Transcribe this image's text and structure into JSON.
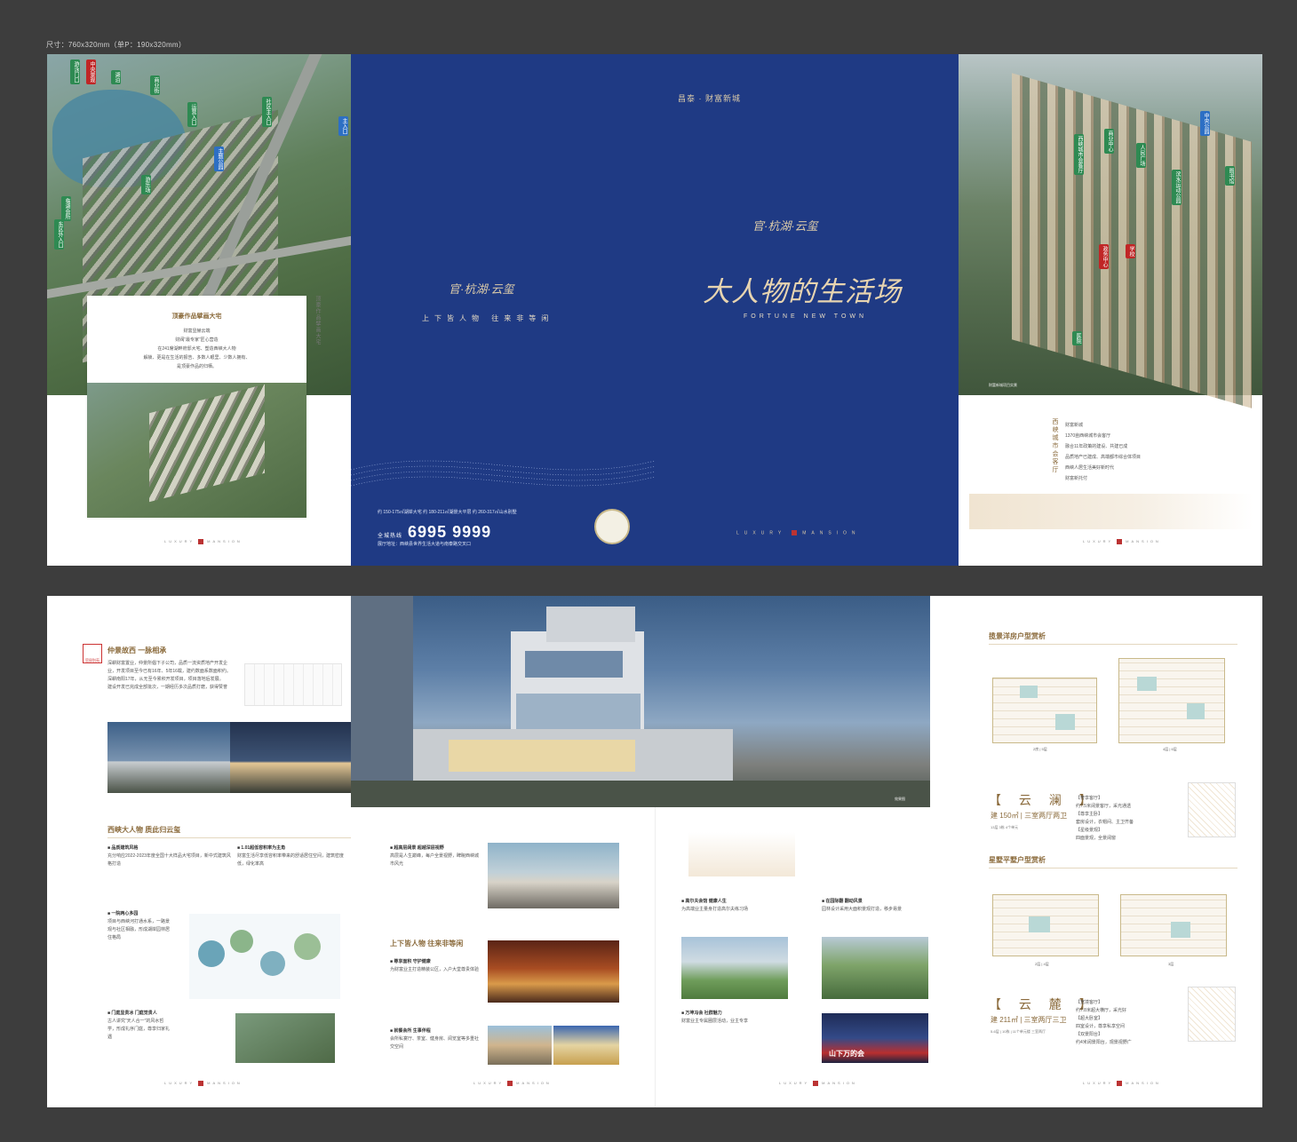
{
  "size_label": "尺寸：760x320mm（单P：190x320mm）",
  "top_left": {
    "card_title": "顶豪作品擘画大宅",
    "card_lines": [
      "财富显赫云端",
      "财阀“最专家”匠心营造",
      "在241席湖畔府邸大宅、塑造西峡大人物",
      "解锁、更是在生活的报告、多数人眼里、少数人拥有、",
      "是顶豪作品的归栖。"
    ],
    "vertical_title": "顶豪作品擘画大宅",
    "tags": [
      "游泳门口",
      "中央景观",
      "湖泊",
      "商业街",
      "运营入口",
      "社区主入口",
      "主题公园",
      "游乐场",
      "临湖会所",
      "东区外入口",
      "主入口"
    ],
    "footer_left": "LUXURY",
    "footer_right": "MANSION"
  },
  "cover": {
    "logo_small": "昌泰 · 财富新城",
    "logo_left": "官·杭湖·云玺",
    "slogan_left": "上下皆人物   往来非等闲",
    "logo_right": "官·杭湖·云玺",
    "headline": "大人物的生活场",
    "subtitle_en": "FORTUNE NEW TOWN",
    "info_lines": [
      "约 150-175㎡湖岸大宅   约 180-211㎡湖景大平层   约 260-317㎡山水别墅"
    ],
    "phone_prefix": "全城热线",
    "phone": "6995 9999",
    "address": "展厅地址：西峡县世界生活大道与南泰路交叉口",
    "lux_left": "LUXURY",
    "lux_right": "MANSION"
  },
  "top_right": {
    "tags": [
      "西峡城市会客厅",
      "中央公园",
      "商业中心",
      "人民广场",
      "滨水运动公园",
      "图书馆",
      "政务中心",
      "学校",
      "医院"
    ],
    "vertical_title": "西峡城市会客厅",
    "text_lines": [
      "财富新城",
      "1370亩西峡城市会客厅",
      "融合11年政策的建设、共建已成",
      "品质地产已建成、高端都市综合体项目",
      "西峡人居生活美好新时代",
      "财富新托付"
    ],
    "caption": "财富新城项目实景",
    "footer_left": "LUXURY",
    "footer_right": "MANSION"
  },
  "bottom": {
    "brand_badge": "官邸别苑",
    "sec1_title": "仲景故西  一脉相承",
    "sec1_lines": [
      "深耕财富置业，仲景所倡下子公司，品质一流资质地产开发企",
      "业，开发项目至今已有16年、5年16载，建约数面系数面积约。",
      "深耕南阳17年，从无至今累积开发项目，项目落地后发展。",
      "建设开发已完成全部批次，一期经历多次品质打磨，获得赞誉"
    ],
    "sec2_title": "西峡大人物  质此归云玺",
    "col1": [
      {
        "h": "■ 品质建筑风格",
        "t": "充分响应2022-2023年度全国十大样品大宅项目，新中式建筑风格打造"
      },
      {
        "h": "■ 一院两心多园",
        "t": "项目与西峡河打通水系，一路景观与社区相融，形成湖岸园林居住格局"
      },
      {
        "h": "■ 门庭显贵冰 门庭觉贵人",
        "t": "古人讲究“天人合一”的风水哲学，形成礼序门庭，尊享归家礼遇"
      }
    ],
    "col2": [
      {
        "h": "■ 1.01超低容积率为主角",
        "t": "财富生活尽享低容积率带来的舒适居住空间，建筑密度低，绿化率高"
      }
    ],
    "col3": [
      {
        "h": "■ 超高层阔景 超越深层视野",
        "t": "高层是人生巅峰，每户全景视野，睥睨西峡城市风光"
      },
      {
        "h": "■ 尊享面积 守护健康",
        "t": "为财富业主打造精装公区，入户大堂尊贵体验"
      },
      {
        "h": "■ 就餐会所 生事伴程",
        "t": "会所私宴厅、茶室、健身房、阅览室等多重社交空间"
      }
    ],
    "sec3_title": "上下皆人物  往来非等闲",
    "col4": [
      {
        "h": "■ 高尔夫会馆 健康人生",
        "t": "为高端业主量身打造高尔夫练习场"
      },
      {
        "h": "■ 万坤冯会 社群魅力",
        "t": "财富业主专属圈层活动，业主专享"
      }
    ],
    "col5": [
      {
        "h": "■ 在园际翻 翻动风景",
        "t": "园林设计采用大面积景观打造，移步易景"
      }
    ],
    "caption_hero": "效果图",
    "plan1_title": "揽景洋房户型赏析",
    "plan1_labels": [
      "2房 | 5层",
      "4层 | 6层"
    ],
    "unit1_name": "【 云 澜 】",
    "unit1_area": "建 150㎡ | 三室两厅两卫",
    "unit1_note": "13层   3栋   4个单元",
    "unit1_desc": [
      "【奢享客厅】",
      "约7.5米阔景客厅，采光通透",
      "【尊享主卧】",
      "套房设计，衣帽间、主卫齐备",
      "【星级景观】",
      "四面景观，全景阔窗"
    ],
    "plan2_title": "星墅平墅户型赏析",
    "plan2_labels": [
      "2层 | 4层",
      "3层"
    ],
    "unit2_name": "【 云 麓 】",
    "unit2_area": "建 211㎡ | 三室两厅三卫",
    "unit2_note": "5-6层 | 10栋 | 11个单元楼  三室两厅",
    "unit2_desc": [
      "【宽境客厅】",
      "约7.8米超大横厅，采光好",
      "【超大卧室】",
      "四室设计，尊享私享空间",
      "【双景阳台】",
      "约4米阔景阳台，观景视野广"
    ],
    "photo_caption": "实景图",
    "club_text": "山下万的会",
    "footer_left": "LUXURY",
    "footer_right": "MANSION"
  }
}
